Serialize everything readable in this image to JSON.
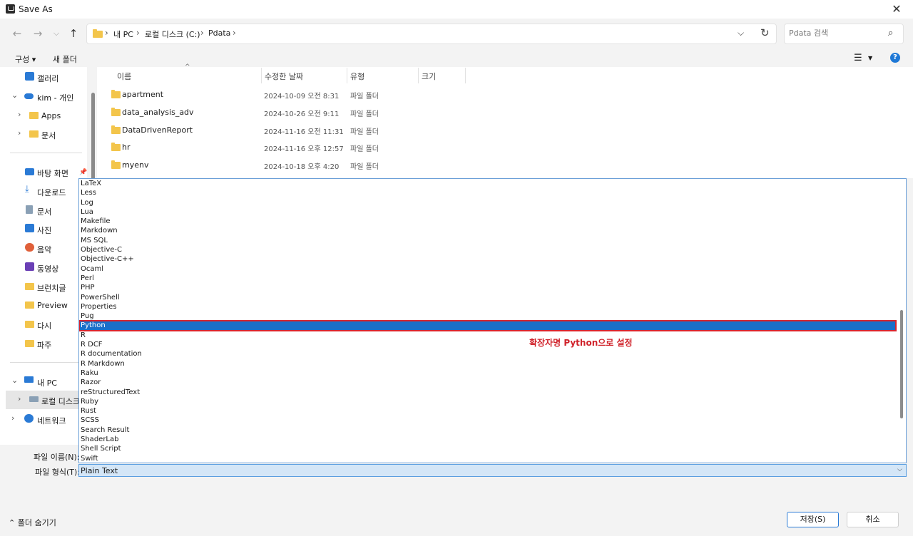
{
  "window": {
    "title": "Save As",
    "close": "✕"
  },
  "nav": {
    "back": "←",
    "forward": "→",
    "recent": "⌵",
    "up": "↑"
  },
  "address": {
    "crumbs": [
      "내 PC",
      "로컬 디스크 (C:)",
      "Pdata"
    ],
    "sep": "›",
    "dropdown": "⌵",
    "refresh": "↻"
  },
  "search": {
    "placeholder": "Pdata 검색",
    "icon": "⌕"
  },
  "toolbar": {
    "organize": "구성 ▾",
    "new_folder": "새 폴더",
    "view_icon": "☰",
    "view_caret": "▼",
    "help": "?"
  },
  "sidebar": {
    "items": [
      {
        "label": "갤러리",
        "icon": "gallery-icon"
      },
      {
        "label": "kim - 개인",
        "icon": "onedrive-icon"
      },
      {
        "label": "Apps",
        "icon": "folder-icon"
      },
      {
        "label": "문서",
        "icon": "folder-icon"
      },
      {
        "label": "바탕 화면",
        "icon": "desktop-icon"
      },
      {
        "label": "다운로드",
        "icon": "download-icon"
      },
      {
        "label": "문서",
        "icon": "documents-icon"
      },
      {
        "label": "사진",
        "icon": "pictures-icon"
      },
      {
        "label": "음악",
        "icon": "music-icon"
      },
      {
        "label": "동영상",
        "icon": "videos-icon"
      },
      {
        "label": "브런치글",
        "icon": "folder-icon"
      },
      {
        "label": "Preview",
        "icon": "folder-icon"
      },
      {
        "label": "다시",
        "icon": "folder-icon"
      },
      {
        "label": "파주",
        "icon": "folder-icon"
      },
      {
        "label": "내 PC",
        "icon": "pc-icon"
      },
      {
        "label": "로컬 디스크",
        "icon": "drive-icon"
      },
      {
        "label": "네트워크",
        "icon": "network-icon"
      }
    ],
    "chevron_right": "›",
    "chevron_down": "⌄",
    "pin": "📌"
  },
  "columns": {
    "name": "이름",
    "date": "수정한 날짜",
    "type": "유형",
    "size": "크기",
    "sort": "^"
  },
  "files": [
    {
      "name": "apartment",
      "date": "2024-10-09 오전 8:31",
      "type": "파일 폴더"
    },
    {
      "name": "data_analysis_adv",
      "date": "2024-10-26 오전 9:11",
      "type": "파일 폴더"
    },
    {
      "name": "DataDrivenReport",
      "date": "2024-11-16 오전 11:31",
      "type": "파일 폴더"
    },
    {
      "name": "hr",
      "date": "2024-11-16 오후 12:57",
      "type": "파일 폴더"
    },
    {
      "name": "myenv",
      "date": "2024-10-18 오후 4:20",
      "type": "파일 폴더"
    }
  ],
  "form": {
    "filename_label": "파일 이름(N):",
    "filetype_label": "파일 형식(T):",
    "filetype_value": "Plain Text",
    "caret": "⌵"
  },
  "dropdown_options": [
    "LaTeX",
    "Less",
    "Log",
    "Lua",
    "Makefile",
    "Markdown",
    "MS SQL",
    "Objective-C",
    "Objective-C++",
    "Ocaml",
    "Perl",
    "PHP",
    "PowerShell",
    "Properties",
    "Pug",
    "Python",
    "R",
    "R DCF",
    "R documentation",
    "R Markdown",
    "Raku",
    "Razor",
    "reStructuredText",
    "Ruby",
    "Rust",
    "SCSS",
    "Search Result",
    "ShaderLab",
    "Shell Script",
    "Swift"
  ],
  "selected_option": "Python",
  "annotation": "확장자명 Python으로 설정",
  "footer": {
    "hide_folders": "⌃  폴더 숨기기",
    "save": "저장(S)",
    "cancel": "취소"
  }
}
